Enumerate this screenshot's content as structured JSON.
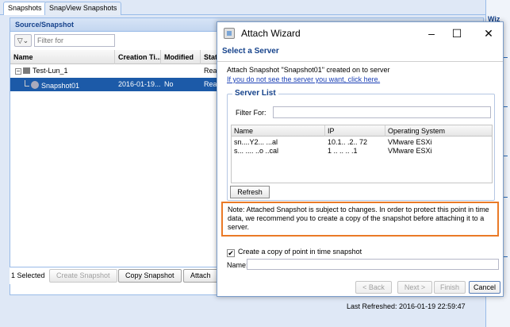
{
  "tabs": [
    "Snapshots",
    "SnapView Snapshots"
  ],
  "panel": {
    "title": "Source/Snapshot",
    "filter_placeholder": "Filter for",
    "columns": [
      "Name",
      "Creation Ti...",
      "Modified",
      "Stat"
    ],
    "rows": [
      {
        "name": "Test-Lun_1",
        "creation": "",
        "modified": "",
        "status": "Read"
      },
      {
        "name": "Snapshot01",
        "creation": "2016-01-19...",
        "modified": "No",
        "status": "Read"
      }
    ]
  },
  "bottom_bar": {
    "selected_count": "1 Selected",
    "buttons": [
      "Create Snapshot",
      "Copy Snapshot",
      "Attach"
    ]
  },
  "status_bar": "Last Refreshed: 2016-01-19 22:59:47",
  "right_tab": "Wiz",
  "dialog": {
    "title": "Attach Wizard",
    "header": "Select a Server",
    "info": "Attach Snapshot \"Snapshot01\" created on  to server",
    "link": "If you do not see the server you want, click here.",
    "server_list": {
      "legend": "Server List",
      "filter_label": "Filter For:",
      "columns": [
        "Name",
        "IP",
        "Operating System"
      ],
      "rows": [
        {
          "name": "sn....Y2...  ...al",
          "ip": "10.1.. .2.. 72",
          "os": "VMware ESXi"
        },
        {
          "name": "s... .... ..o  ..cal",
          "ip": "1 ..  ..  .. .1",
          "os": "VMware ESXi"
        }
      ],
      "refresh": "Refresh"
    },
    "note": "Note: Attached Snapshot is subject to changes. In order to protect this point in time data, we recommend you to create a copy of the snapshot before attaching it to a server.",
    "copy_checkbox_label": "Create a copy of point in time snapshot",
    "name_label": "Name:",
    "buttons": {
      "back": "< Back",
      "next": "Next >",
      "finish": "Finish",
      "cancel": "Cancel"
    }
  }
}
